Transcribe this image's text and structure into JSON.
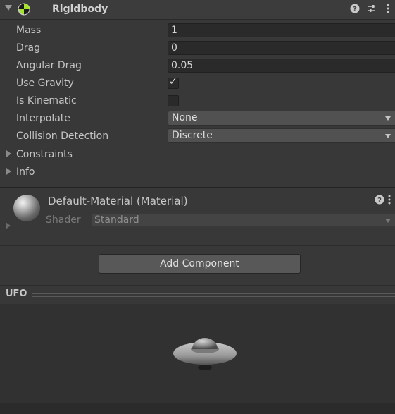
{
  "component": {
    "title": "Rigidbody",
    "header_icons": [
      "help-icon",
      "preset-icon",
      "more-icon"
    ]
  },
  "rigidbody": {
    "mass": {
      "label": "Mass",
      "value": "1"
    },
    "drag": {
      "label": "Drag",
      "value": "0"
    },
    "angular_drag": {
      "label": "Angular Drag",
      "value": "0.05"
    },
    "use_gravity": {
      "label": "Use Gravity",
      "checked": true
    },
    "is_kinematic": {
      "label": "Is Kinematic",
      "checked": false
    },
    "interpolate": {
      "label": "Interpolate",
      "value": "None"
    },
    "collision_detection": {
      "label": "Collision Detection",
      "value": "Discrete"
    },
    "constraints": {
      "label": "Constraints"
    },
    "info": {
      "label": "Info"
    }
  },
  "material": {
    "title": "Default-Material (Material)",
    "shader_label": "Shader",
    "shader_value": "Standard"
  },
  "add_component": {
    "label": "Add Component"
  },
  "preview": {
    "title": "UFO"
  },
  "colors": {
    "background": "#383838",
    "field": "#2a2a2a",
    "dropdown": "#515151",
    "button": "#585858"
  }
}
